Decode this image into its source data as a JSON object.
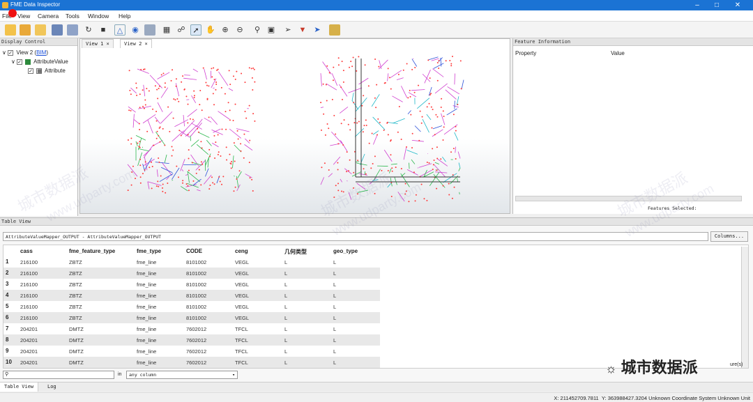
{
  "app": {
    "title": "FME Data Inspector"
  },
  "menu": [
    "File",
    "View",
    "Camera",
    "Tools",
    "Window",
    "Help"
  ],
  "display_control": {
    "title": "Display Control",
    "items": [
      "View 2 (",
      "BIM",
      ")",
      "AttributeValue",
      "Attribute"
    ]
  },
  "views": {
    "tabs": [
      "View 1",
      "View 2"
    ]
  },
  "feature_info": {
    "title": "Feature Information",
    "col_property": "Property",
    "col_value": "Value",
    "features_selected": "Features Selected:"
  },
  "table_view": {
    "title": "Table View",
    "path": "AttributeValueMapper_OUTPUT - AttributeValueMapper_OUTPUT",
    "columns_button": "Columns...",
    "headers": [
      "cass",
      "fme_feature_type",
      "fme_type",
      "CODE",
      "ceng",
      "几何类型",
      "geo_type"
    ],
    "rows": [
      [
        "1",
        "216100",
        "ZBTZ",
        "fme_line",
        "8101002",
        "VEGL",
        "L",
        "L"
      ],
      [
        "2",
        "216100",
        "ZBTZ",
        "fme_line",
        "8101002",
        "VEGL",
        "L",
        "L"
      ],
      [
        "3",
        "216100",
        "ZBTZ",
        "fme_line",
        "8101002",
        "VEGL",
        "L",
        "L"
      ],
      [
        "4",
        "216100",
        "ZBTZ",
        "fme_line",
        "8101002",
        "VEGL",
        "L",
        "L"
      ],
      [
        "5",
        "216100",
        "ZBTZ",
        "fme_line",
        "8101002",
        "VEGL",
        "L",
        "L"
      ],
      [
        "6",
        "216100",
        "ZBTZ",
        "fme_line",
        "8101002",
        "VEGL",
        "L",
        "L"
      ],
      [
        "7",
        "204201",
        "DMTZ",
        "fme_line",
        "7602012",
        "TFCL",
        "L",
        "L"
      ],
      [
        "8",
        "204201",
        "DMTZ",
        "fme_line",
        "7602012",
        "TFCL",
        "L",
        "L"
      ],
      [
        "9",
        "204201",
        "DMTZ",
        "fme_line",
        "7602012",
        "TFCL",
        "L",
        "L"
      ],
      [
        "10",
        "204201",
        "DMTZ",
        "fme_line",
        "7602012",
        "TFCL",
        "L",
        "L"
      ]
    ],
    "search_in_label": "in",
    "search_in_value": "any column",
    "row_count_suffix": "ure(s)"
  },
  "bottom_tabs": [
    "Table View",
    "Log"
  ],
  "status": {
    "x_label": "X:",
    "x": "211452709.7811",
    "y_label": "Y:",
    "y": "363988427.3204",
    "crs": "Unknown Coordinate System Unknown Unit"
  },
  "watermark": {
    "cn": "城市数据派",
    "en": "www.udparty.com"
  },
  "brand": "城市数据派",
  "colors": {
    "titlebar": "#1b73d4",
    "points": "#ff3b3b",
    "green_lines": "#2db84f",
    "magenta": "#d040d0",
    "blue": "#2a4fd8",
    "cyan": "#20b8c8"
  }
}
